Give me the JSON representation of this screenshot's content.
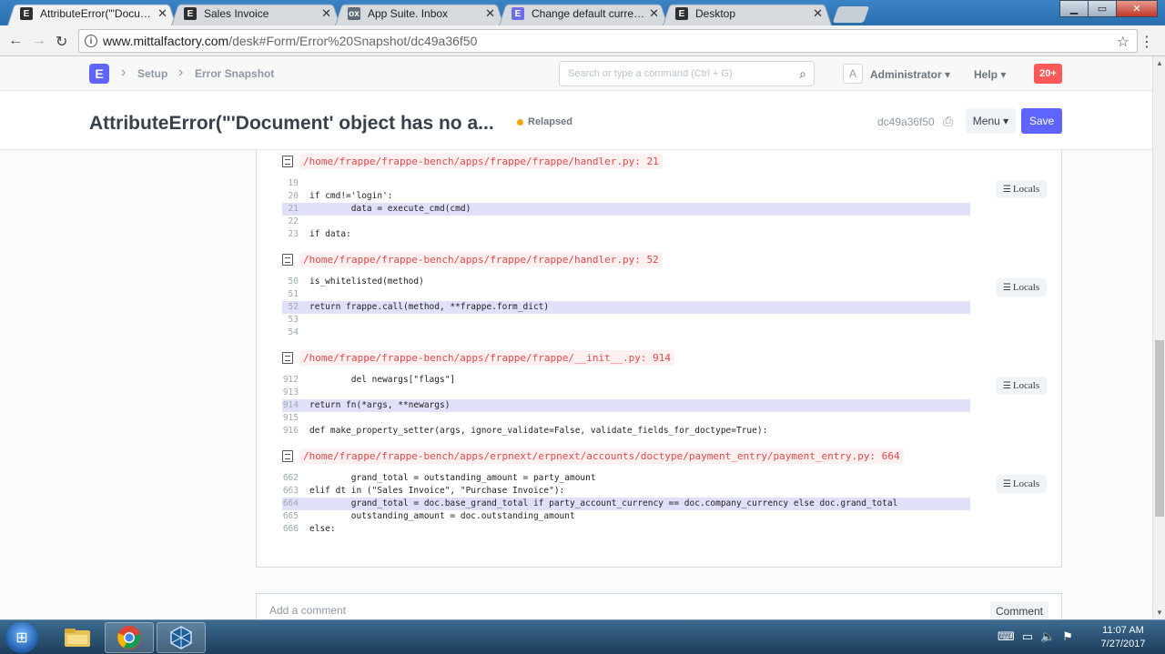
{
  "browser": {
    "tabs": [
      {
        "title": "AttributeError(\"'Documen",
        "fav_letter": "E",
        "fav_color": "#2f2f2f",
        "active": true
      },
      {
        "title": "Sales Invoice",
        "fav_letter": "E",
        "fav_color": "#2f2f2f",
        "active": false
      },
      {
        "title": "App Suite. Inbox",
        "fav_letter": "ox",
        "fav_color": "#5f6b78",
        "active": false
      },
      {
        "title": "Change default currency",
        "fav_letter": "E",
        "fav_color": "#6e6ee8",
        "active": false
      },
      {
        "title": "Desktop",
        "fav_letter": "E",
        "fav_color": "#2f2f2f",
        "active": false
      }
    ],
    "url_domain": "www.mittalfactory.com",
    "url_path": "/desk#Form/Error%20Snapshot/dc49a36f50"
  },
  "nav": {
    "logo": "E",
    "breadcrumb": [
      "Setup",
      "Error Snapshot"
    ],
    "search_placeholder": "Search or type a command (Ctrl + G)",
    "avatar_letter": "A",
    "user": "Administrator",
    "help": "Help",
    "notifications": "20+"
  },
  "page": {
    "title": "AttributeError(\"'Document' object has no a...",
    "status": "Relapsed",
    "doc_id": "dc49a36f50",
    "menu_label": "Menu",
    "save_label": "Save"
  },
  "frames": [
    {
      "path": "/home/frappe/frappe-bench/apps/frappe/frappe/handler.py: 21",
      "lines": [
        {
          "n": "19",
          "code": "",
          "hl": false
        },
        {
          "n": "20",
          "code": "if cmd!='login':",
          "hl": false
        },
        {
          "n": "21",
          "code": "        data = execute_cmd(cmd)",
          "hl": true
        },
        {
          "n": "22",
          "code": "",
          "hl": false
        },
        {
          "n": "23",
          "code": "if data:",
          "hl": false
        }
      ]
    },
    {
      "path": "/home/frappe/frappe-bench/apps/frappe/frappe/handler.py: 52",
      "lines": [
        {
          "n": "50",
          "code": "is_whitelisted(method)",
          "hl": false
        },
        {
          "n": "51",
          "code": "",
          "hl": false
        },
        {
          "n": "52",
          "code": "return frappe.call(method, **frappe.form_dict)",
          "hl": true
        },
        {
          "n": "53",
          "code": "",
          "hl": false
        },
        {
          "n": "54",
          "code": "",
          "hl": false
        }
      ]
    },
    {
      "path": "/home/frappe/frappe-bench/apps/frappe/frappe/__init__.py: 914",
      "lines": [
        {
          "n": "912",
          "code": "        del newargs[\"flags\"]",
          "hl": false
        },
        {
          "n": "913",
          "code": "",
          "hl": false
        },
        {
          "n": "914",
          "code": "return fn(*args, **newargs)",
          "hl": true
        },
        {
          "n": "915",
          "code": "",
          "hl": false
        },
        {
          "n": "916",
          "code": "def make_property_setter(args, ignore_validate=False, validate_fields_for_doctype=True):",
          "hl": false
        }
      ]
    },
    {
      "path": "/home/frappe/frappe-bench/apps/erpnext/erpnext/accounts/doctype/payment_entry/payment_entry.py: 664",
      "lines": [
        {
          "n": "662",
          "code": "        grand_total = outstanding_amount = party_amount",
          "hl": false
        },
        {
          "n": "663",
          "code": "elif dt in (\"Sales Invoice\", \"Purchase Invoice\"):",
          "hl": false
        },
        {
          "n": "664",
          "code": "        grand_total = doc.base_grand_total if party_account_currency == doc.company_currency else doc.grand_total",
          "hl": true
        },
        {
          "n": "665",
          "code": "        outstanding_amount = doc.outstanding_amount",
          "hl": false
        },
        {
          "n": "666",
          "code": "else:",
          "hl": false
        }
      ]
    }
  ],
  "locals_label": "Locals",
  "comment": {
    "placeholder": "Add a comment",
    "button": "Comment"
  },
  "taskbar": {
    "time": "11:07 AM",
    "date": "7/27/2017"
  }
}
